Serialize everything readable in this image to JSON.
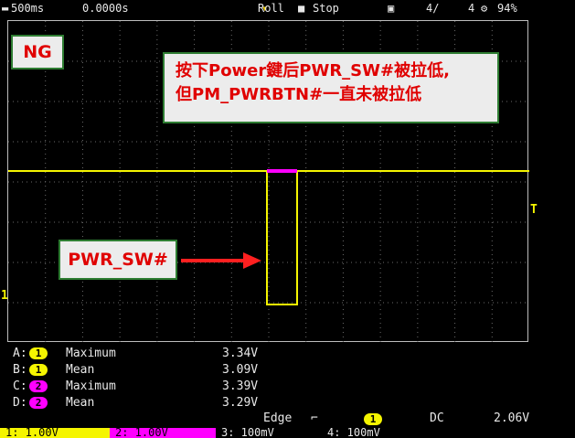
{
  "header": {
    "timebase": "500ms",
    "delay": "0.0000s",
    "mode": "Roll",
    "run_state": "Stop",
    "acq_count": "4/",
    "acq_total": "4",
    "battery": "94%"
  },
  "annotations": {
    "ng_label": "NG",
    "callout_line1": "按下Power鍵后PWR_SW#被拉低,",
    "callout_line2": "但PM_PWRBTN#一直未被拉低",
    "signal_label": "PWR_SW#"
  },
  "markers": {
    "trigger_level": "T",
    "channel1": "1"
  },
  "measurements": [
    {
      "slot": "A:",
      "channel": "1",
      "type": "Maximum",
      "value": "3.34V"
    },
    {
      "slot": "B:",
      "channel": "1",
      "type": "Mean",
      "value": "3.09V"
    },
    {
      "slot": "C:",
      "channel": "2",
      "type": "Maximum",
      "value": "3.39V"
    },
    {
      "slot": "D:",
      "channel": "2",
      "type": "Mean",
      "value": "3.29V"
    }
  ],
  "trigger": {
    "type": "Edge",
    "source": "1",
    "coupling": "DC",
    "level": "2.06V"
  },
  "channels": [
    {
      "label": "1: 1.00V"
    },
    {
      "label": "2: 1.00V"
    },
    {
      "label": "3: 100mV"
    },
    {
      "label": "4: 100mV"
    }
  ],
  "colors": {
    "ch1": "#f5f500",
    "ch2": "#ff00ff",
    "ch3": "#ffffff",
    "ch4": "#ffffff",
    "annotation_border": "#2e7d32",
    "annotation_text": "#e00000"
  }
}
